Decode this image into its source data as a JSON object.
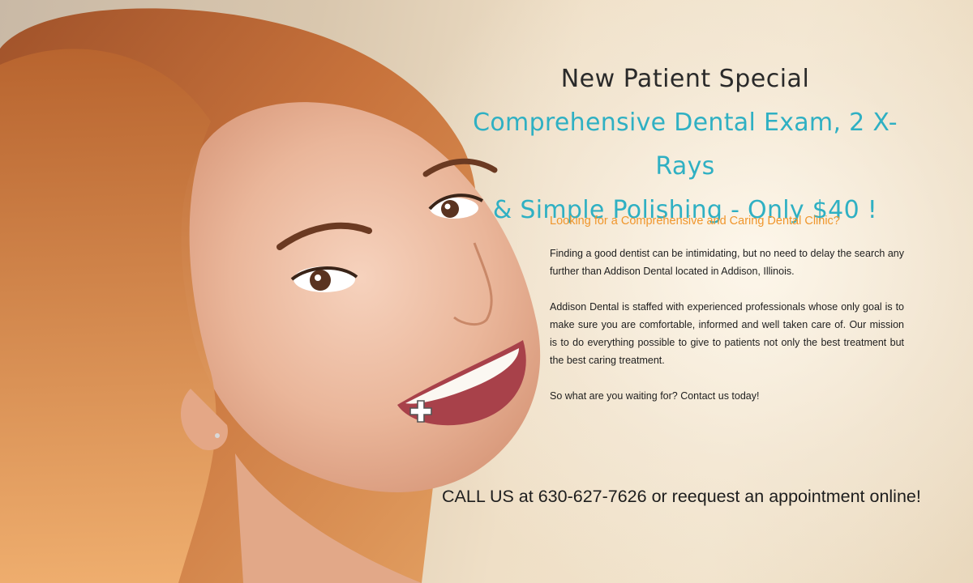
{
  "promo": {
    "kicker": "New Patient Special",
    "offer_line_1": "Comprehensive Dental Exam, 2 X-Rays",
    "offer_line_2": "& Simple Polishing - Only $40 !"
  },
  "body": {
    "question": "Looking for a Comprehensive and Caring Dental Clinic?",
    "paragraph_1": "Finding a good dentist can be intimidating, but no need to delay the search any further than Addison Dental located in Addison, Illinois.",
    "paragraph_2": "Addison Dental is staffed with experienced professionals whose only goal is to make sure you are comfortable, informed and well taken care of. Our mission is to do everything possible to give to patients not only the best treatment but the best caring treatment.",
    "paragraph_3": "So what are you waiting for? Contact us today!"
  },
  "cta": {
    "text": "CALL US at 630-627-7626 or reequest an appointment online!"
  },
  "colors": {
    "accent_teal": "#2fb0c3",
    "accent_orange": "#f0962c",
    "text_dark": "#1e1e1e"
  },
  "icons": {
    "cursor": "crosshair-plus-icon"
  }
}
